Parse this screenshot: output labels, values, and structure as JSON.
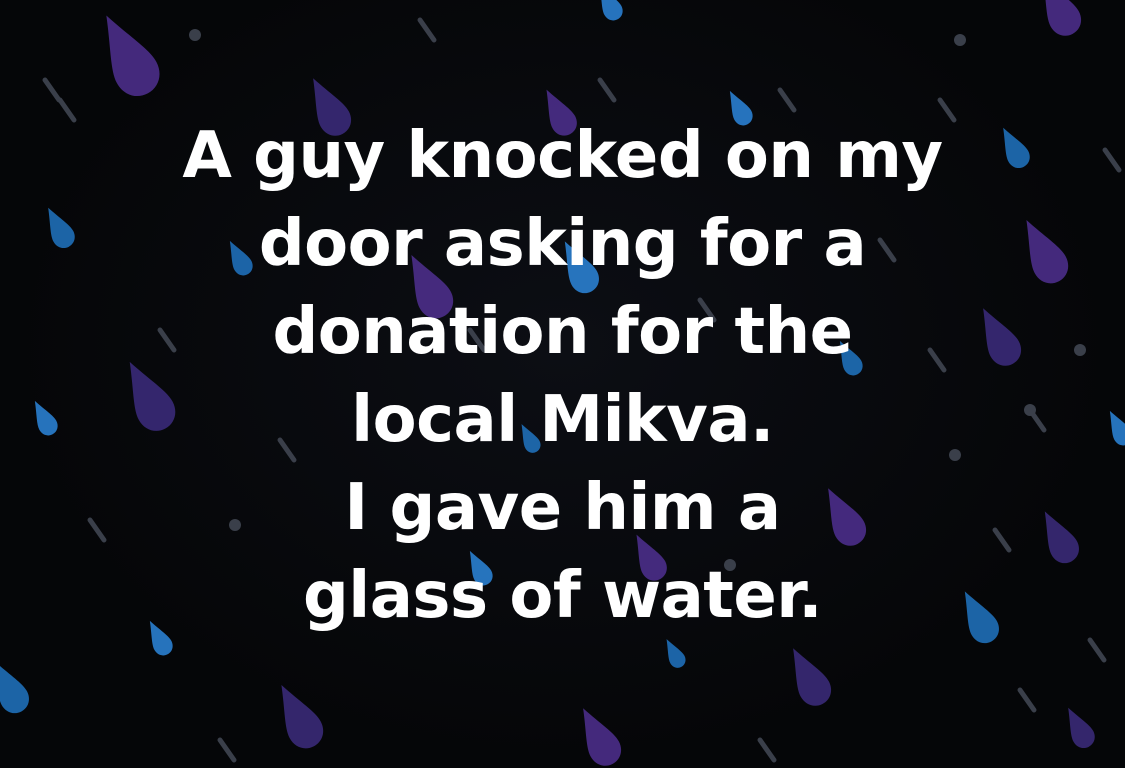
{
  "background": {
    "base_color": "#050608",
    "drop_colors": [
      "#4b2e8a",
      "#3a2a78",
      "#1f6fb8",
      "#2a7fd0"
    ],
    "streak_color": "#3a3f4a"
  },
  "caption": {
    "lines": [
      "A guy knocked on my",
      "door asking for a",
      "donation for the",
      "local Mikva.",
      "I gave him a",
      "glass of water."
    ],
    "text_color": "#ffffff"
  }
}
